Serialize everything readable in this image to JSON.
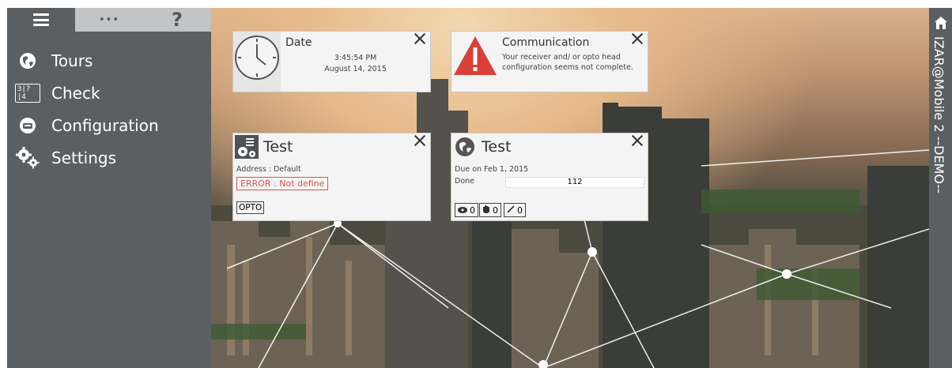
{
  "sidebar": {
    "topbar": {
      "more_label": "•••",
      "help_label": "?"
    },
    "items": [
      {
        "label": "Tours",
        "icon": "globe-icon"
      },
      {
        "label": "Check",
        "icon": "check-counter-icon",
        "icon_text": "3|?|4"
      },
      {
        "label": "Configuration",
        "icon": "receiver-icon"
      },
      {
        "label": "Settings",
        "icon": "gears-icon"
      }
    ]
  },
  "rightbar": {
    "label": "IZAR@Mobile 2  --DEMO--"
  },
  "cards": {
    "date": {
      "title": "Date",
      "time": "3:45:54 PM",
      "date": "August 14, 2015"
    },
    "communication": {
      "title": "Communication",
      "message": "Your receiver and/ or opto head configuration seems not complete."
    },
    "config_test": {
      "title": "Test",
      "address": "Address : Default",
      "error": "ERROR : Not define",
      "opto_label": "OPTO"
    },
    "tour_test": {
      "title": "Test",
      "due": "Due on Feb 1, 2015",
      "done_label": "Done",
      "done_value": "112",
      "stats": [
        {
          "icon": "eye-icon",
          "value": "0"
        },
        {
          "icon": "hand-icon",
          "value": "0"
        },
        {
          "icon": "pencil-icon",
          "value": "0"
        }
      ]
    }
  },
  "colors": {
    "sidebar": "#5c5f62",
    "card": "#f4f4f4",
    "error": "#d9534f",
    "warning": "#d9403a"
  }
}
